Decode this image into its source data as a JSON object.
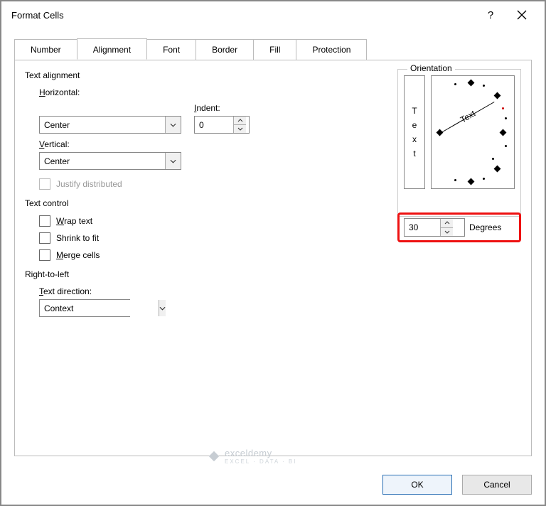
{
  "title": "Format Cells",
  "titlebar": {
    "help": "?",
    "close": "✕"
  },
  "tabs": [
    "Number",
    "Alignment",
    "Font",
    "Border",
    "Fill",
    "Protection"
  ],
  "activeTab": 1,
  "alignment": {
    "section": "Text alignment",
    "horizontal_label": "Horizontal:",
    "horizontal_u": "H",
    "horizontal_value": "Center",
    "vertical_label": "Vertical:",
    "vertical_u": "V",
    "vertical_value": "Center",
    "indent_label": "Indent:",
    "indent_u": "I",
    "indent_value": "0",
    "justify_label": "Justify distributed"
  },
  "textcontrol": {
    "section": "Text control",
    "wrap": "Wrap text",
    "wrap_u": "W",
    "shrink": "Shrink to fit",
    "merge": "Merge cells",
    "merge_u": "M"
  },
  "rtl": {
    "section": "Right-to-left",
    "label": "Text direction:",
    "label_u": "T",
    "value": "Context"
  },
  "orientation": {
    "label": "Orientation",
    "vtext": [
      "T",
      "e",
      "x",
      "t"
    ],
    "dial_text": "Text",
    "degrees": "30",
    "degrees_label": "Degrees",
    "degrees_u": "D"
  },
  "buttons": {
    "ok": "OK",
    "cancel": "Cancel"
  },
  "watermark": {
    "brand": "exceldemy",
    "sub": "EXCEL · DATA · BI"
  }
}
